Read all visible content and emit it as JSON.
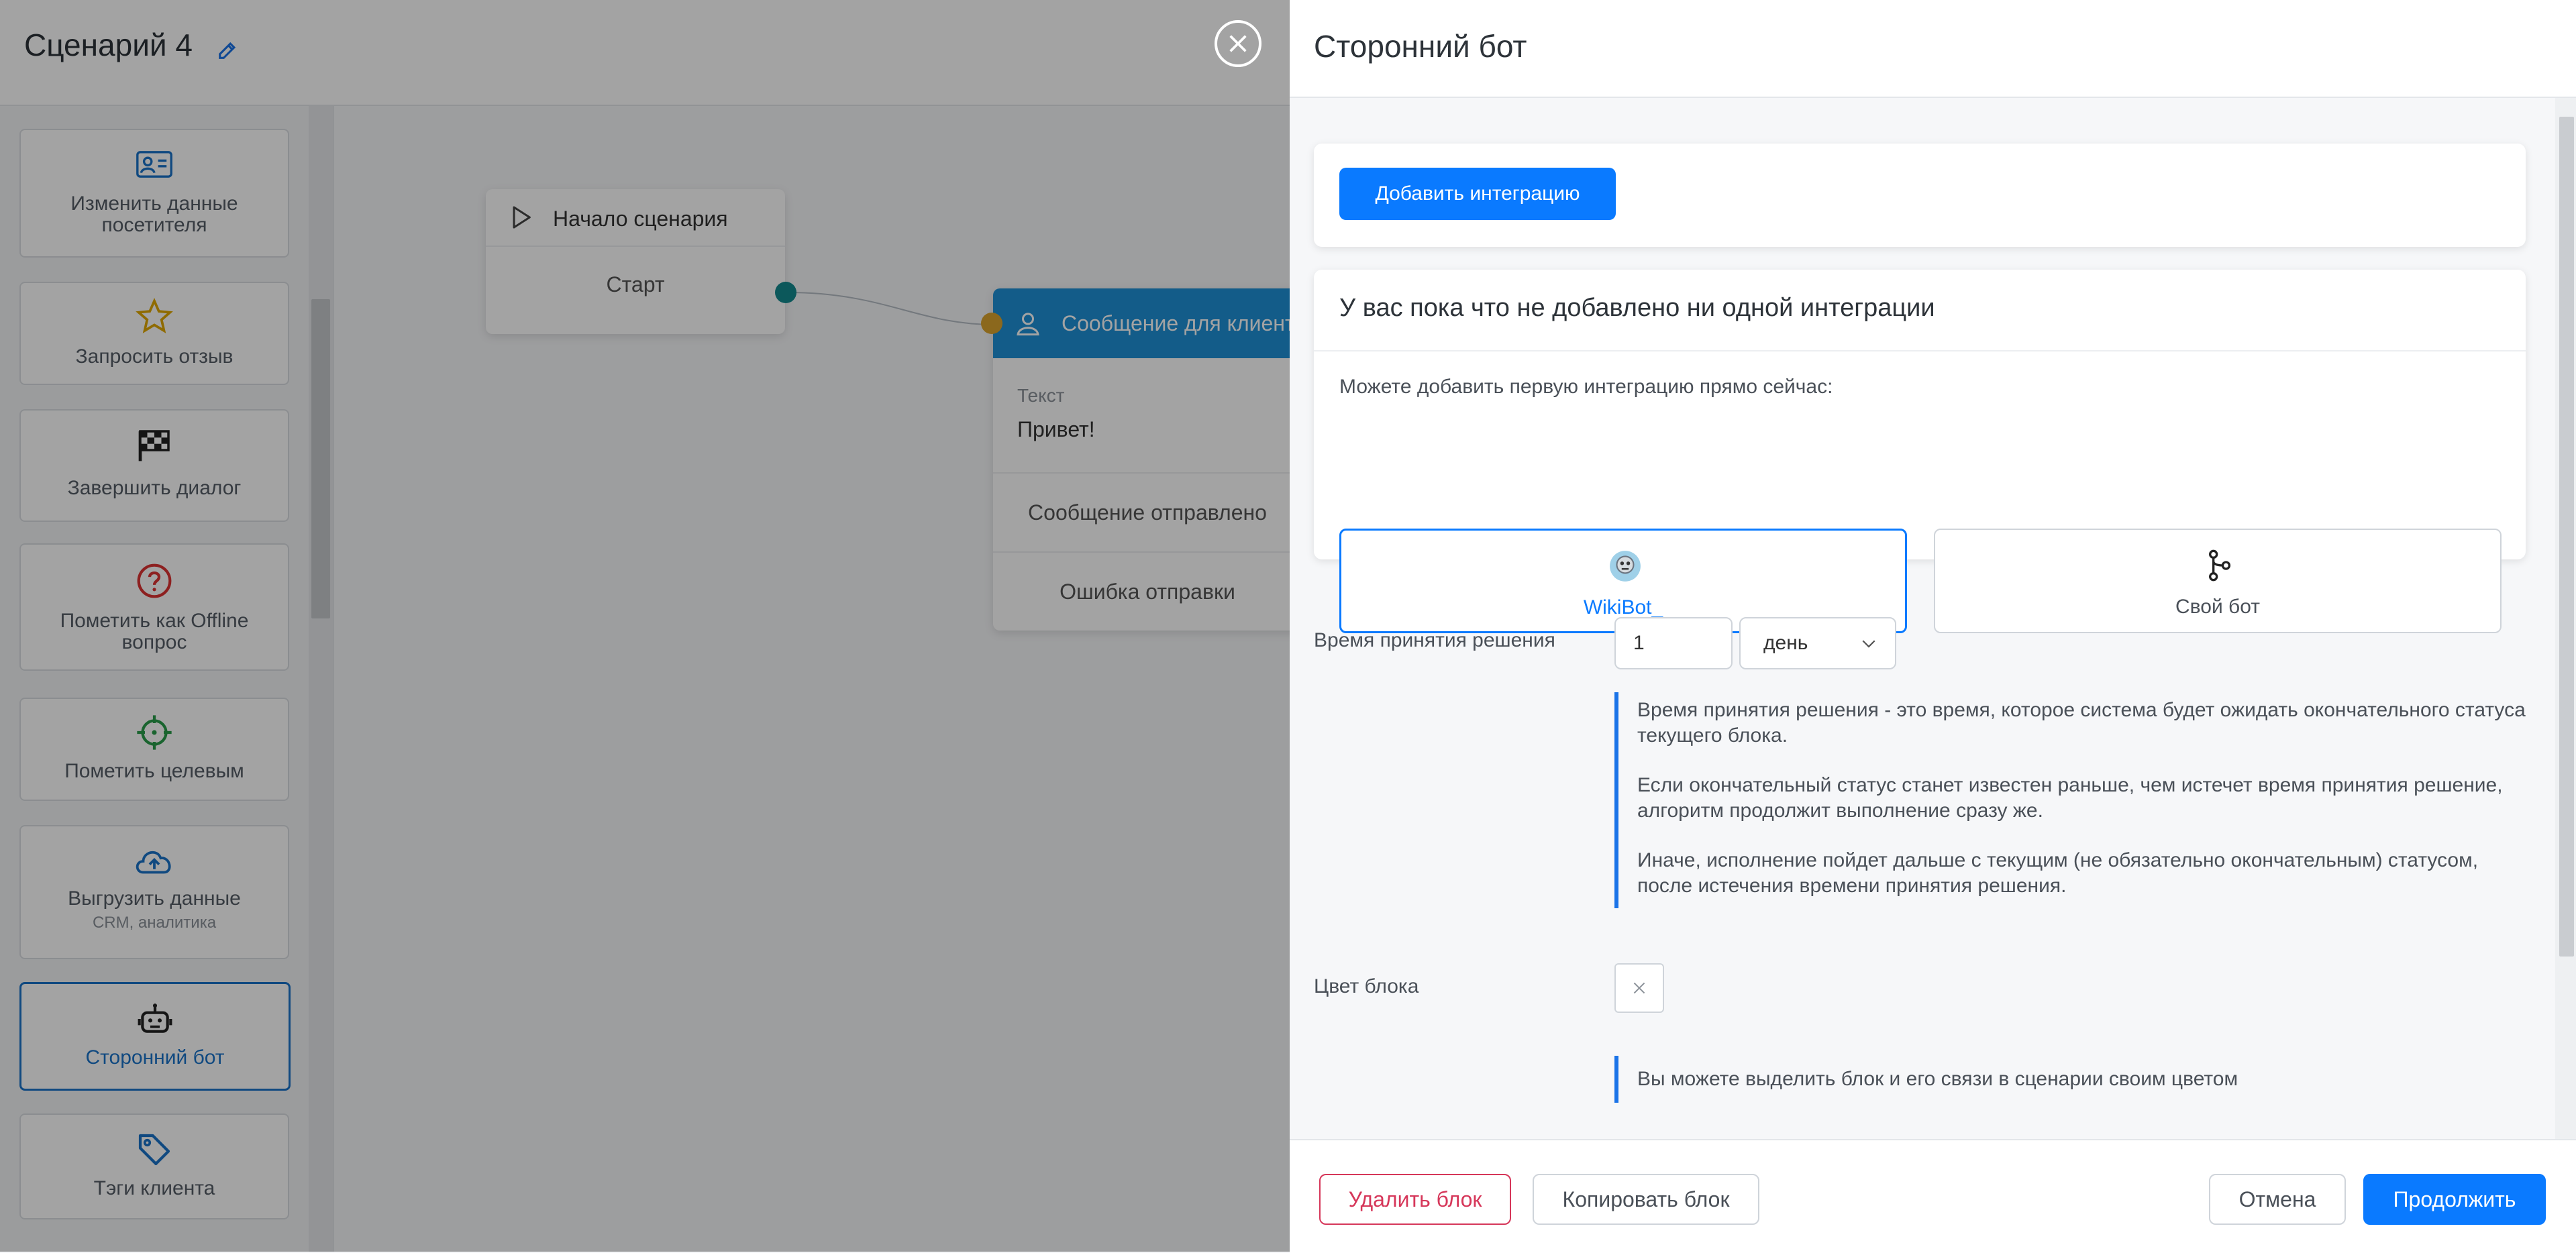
{
  "editor": {
    "title": "Сценарий 4",
    "palette": [
      {
        "label": "Изменить данные посетителя",
        "icon": "contact-card-icon"
      },
      {
        "label": "Запросить отзыв",
        "icon": "star-icon"
      },
      {
        "label": "Завершить диалог",
        "icon": "checkered-flag-icon"
      },
      {
        "label": "Пометить как Offline вопрос",
        "icon": "question-circle-icon"
      },
      {
        "label": "Пометить целевым",
        "icon": "crosshair-icon"
      },
      {
        "label": "Выгрузить данные",
        "sub": "CRM, аналитика",
        "icon": "cloud-upload-icon"
      },
      {
        "label": "Сторонний бот",
        "icon": "robot-icon"
      },
      {
        "label": "Тэги клиента",
        "icon": "tag-icon"
      }
    ],
    "nodes": {
      "start": {
        "title": "Начало сценария",
        "row": "Старт"
      },
      "message": {
        "title": "Сообщение для клиента",
        "text_label": "Текст",
        "text_value": "Привет!",
        "out1": "Сообщение отправлено",
        "out2": "Ошибка отправки"
      }
    },
    "colors": {
      "start_connector": "#138a8f",
      "message_connector": "#d9a32e",
      "message_header": "#1e90d6"
    }
  },
  "panel": {
    "title": "Сторонний бот",
    "add_integration_label": "Добавить интеграцию",
    "empty_heading": "У вас пока что не добавлено ни одной интеграции",
    "empty_hint": "Можете добавить первую интеграцию прямо сейчас:",
    "integrations": [
      {
        "label": "WikiBot_",
        "icon": "wikibot-avatar-icon",
        "selected": true
      },
      {
        "label": "Свой бот",
        "icon": "git-branch-icon",
        "selected": false
      }
    ],
    "decision_time": {
      "label": "Время принятия решения",
      "value": "1",
      "unit": "день",
      "hints": [
        "Время принятия решения - это время, которое система будет ожидать окончательного статуса текущего блока.",
        "Если окончательный статус станет известен раньше, чем истечет время принятия решение, алгоритм продолжит выполнение сразу же.",
        "Иначе, исполнение пойдет дальше с текущим (не обязательно окончательным) статусом, после истечения времени принятия решения."
      ]
    },
    "block_color": {
      "label": "Цвет блока",
      "hint": "Вы можете выделить блок и его связи в сценарии своим цветом"
    },
    "footer": {
      "delete": "Удалить блок",
      "copy": "Копировать блок",
      "cancel": "Отмена",
      "continue": "Продолжить"
    },
    "colors": {
      "accent": "#0a7aff",
      "danger": "#d6375a"
    }
  }
}
